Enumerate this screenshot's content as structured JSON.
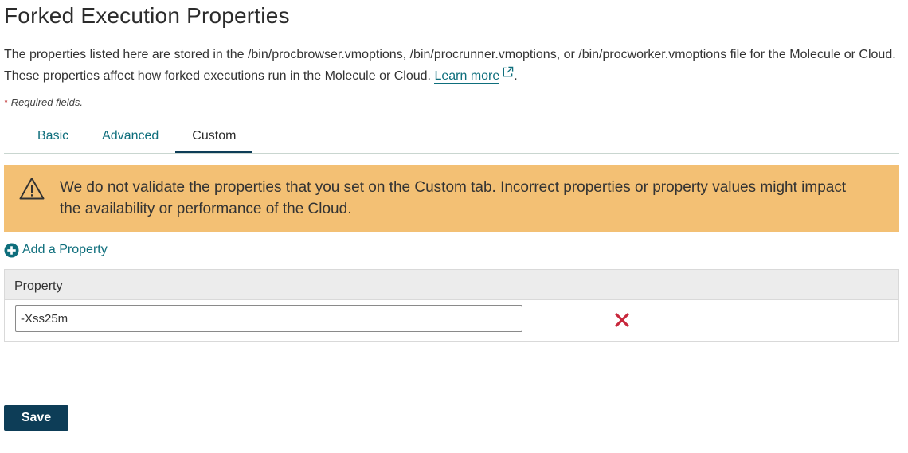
{
  "page": {
    "title": "Forked Execution Properties",
    "description": "The properties listed here are stored in the /bin/procbrowser.vmoptions, /bin/procrunner.vmoptions, or /bin/procworker.vmoptions file for the Molecule or Cloud. These properties affect how forked executions run in the Molecule or Cloud.",
    "learn_more": "Learn more",
    "learn_more_suffix": ".",
    "required_star": "*",
    "required_text": "Required fields."
  },
  "tabs": [
    {
      "label": "Basic",
      "active": false
    },
    {
      "label": "Advanced",
      "active": false
    },
    {
      "label": "Custom",
      "active": true
    }
  ],
  "warning": {
    "icon": "warning-triangle-icon",
    "text": "We do not validate the properties that you set on the Custom tab. Incorrect properties or property values might impact the availability or performance of the Cloud.",
    "background_color": "#f3c074"
  },
  "add_property": {
    "icon": "plus-circle-icon",
    "label": "Add a Property"
  },
  "property_table": {
    "header": "Property",
    "rows": [
      {
        "value": "-Xss25m",
        "remove_icon": "remove-x-icon"
      }
    ]
  },
  "actions": {
    "save_label": "Save"
  },
  "colors": {
    "accent": "#0e6e7c",
    "primary_button": "#0d3d57",
    "remove": "#c8283c"
  }
}
